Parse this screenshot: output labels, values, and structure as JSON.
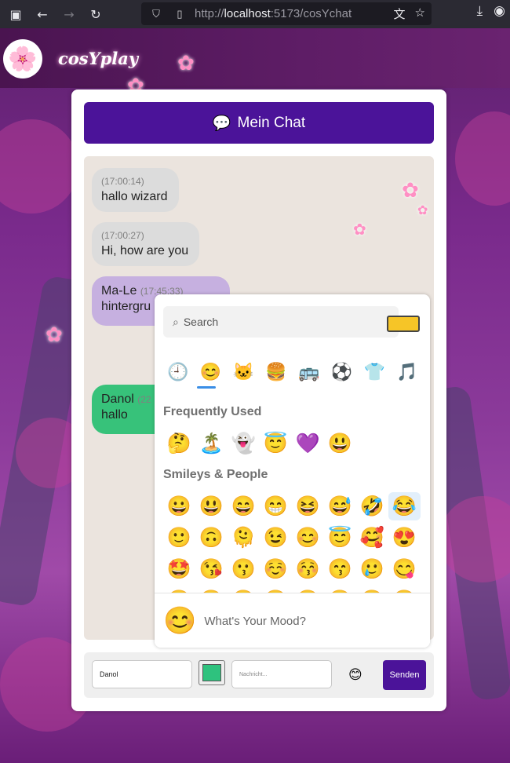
{
  "browser": {
    "url_prefix": "http://",
    "url_host": "localhost",
    "url_rest": ":5173/cosYchat",
    "icons": [
      "sidebar-icon",
      "back-icon",
      "forward-icon",
      "reload-icon",
      "shield-icon",
      "page-icon",
      "translate-icon",
      "bookmark-star-icon",
      "download-icon",
      "account-icon"
    ]
  },
  "header": {
    "brand": "cosYplay",
    "logo_glyph": "🌸"
  },
  "chat": {
    "title": "Mein Chat",
    "title_icon": "💬",
    "messages": [
      {
        "sender": "",
        "time": "(17:00:14)",
        "text": "hallo wizard",
        "style": "gray"
      },
      {
        "sender": "",
        "time": "(17:00:27)",
        "text": "Hi, how are you",
        "style": "gray"
      },
      {
        "sender": "Ma-Le",
        "time": "(17:45:33)",
        "text": "hintergru",
        "style": "purple"
      },
      {
        "sender": "Danol",
        "time": "(22",
        "text": "hallo",
        "style": "green"
      }
    ]
  },
  "emoji_picker": {
    "search_placeholder": "Search",
    "skin_tone_color": "#f6c527",
    "categories": [
      "🕘",
      "😊",
      "🐱",
      "🍔",
      "🚌",
      "⚽",
      "👕",
      "🎵"
    ],
    "frequently_used_title": "Frequently Used",
    "frequently_used": [
      "🤔",
      "🏝️",
      "👻",
      "😇",
      "💜",
      "😃"
    ],
    "smileys_title": "Smileys & People",
    "smileys_rows": [
      [
        "😀",
        "😃",
        "😄",
        "😁",
        "😆",
        "😅",
        "🤣",
        "😂"
      ],
      [
        "🙂",
        "🙃",
        "🫠",
        "😉",
        "😊",
        "😇",
        "🥰",
        "😍"
      ],
      [
        "🤩",
        "😘",
        "😗",
        "☺️",
        "😚",
        "😙",
        "🥲",
        "😋"
      ],
      [
        "😛",
        "😜",
        "🤪",
        "😝",
        "🤑",
        "🤗",
        "🤭",
        "🫢"
      ]
    ],
    "mood_emoji": "😊",
    "mood_placeholder": "What's Your Mood?"
  },
  "input": {
    "name_value": "Danol",
    "color_value": "#2ec27e",
    "message_placeholder": "Nachricht...",
    "emoji_button": "😊",
    "send_label": "Senden"
  }
}
